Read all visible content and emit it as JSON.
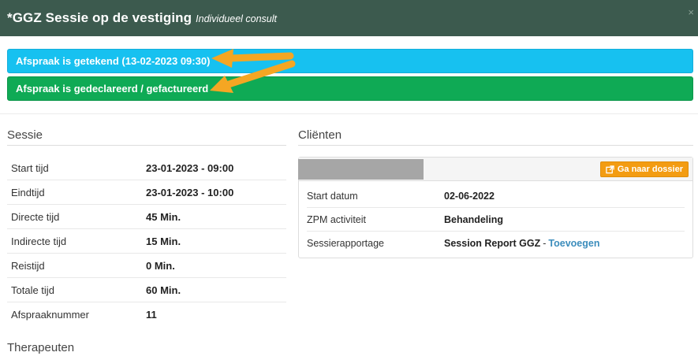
{
  "header": {
    "title": "*GGZ Sessie op de vestiging",
    "subtitle": "Individueel consult",
    "close_glyph": "×"
  },
  "alerts": {
    "signed": "Afspraak is getekend (13-02-2023 09:30)",
    "declared": "Afspraak is gedeclareerd / gefactureerd"
  },
  "colors": {
    "header_bg": "#3c5a4e",
    "signed_bg": "#17c1f0",
    "declared_bg": "#0faa55",
    "button_bg": "#f39c12",
    "arrow": "#f5a623",
    "link": "#3c8dbc"
  },
  "sessie": {
    "title": "Sessie",
    "rows": [
      {
        "label": "Start tijd",
        "value": "23-01-2023 - 09:00"
      },
      {
        "label": "Eindtijd",
        "value": "23-01-2023 - 10:00"
      },
      {
        "label": "Directe tijd",
        "value": "45 Min."
      },
      {
        "label": "Indirecte tijd",
        "value": "15 Min."
      },
      {
        "label": "Reistijd",
        "value": "0 Min."
      },
      {
        "label": "Totale tijd",
        "value": "60 Min."
      },
      {
        "label": "Afspraaknummer",
        "value": "11"
      }
    ]
  },
  "clienten": {
    "title": "Cliënten",
    "dossier_button": "Ga naar dossier",
    "dossier_icon": "external-link-icon",
    "rows": [
      {
        "label": "Start datum",
        "value": "02-06-2022"
      },
      {
        "label": "ZPM activiteit",
        "value": "Behandeling"
      }
    ],
    "report": {
      "label": "Sessierapportage",
      "value": "Session Report GGZ",
      "separator": "-",
      "link": "Toevoegen"
    }
  },
  "therapeuten": {
    "title": "Therapeuten"
  }
}
